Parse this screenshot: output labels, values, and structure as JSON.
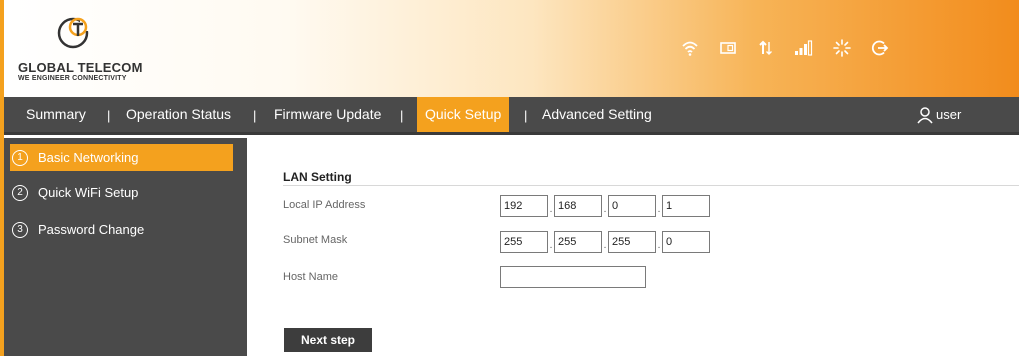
{
  "brand": {
    "name": "GLOBAL TELECOM",
    "tagline": "WE ENGINEER CONNECTIVITY"
  },
  "status_icons": [
    "wifi-icon",
    "sim-card-icon",
    "data-transfer-icon",
    "signal-strength-icon",
    "loading-icon",
    "logout-icon"
  ],
  "nav": {
    "items": [
      {
        "label": "Summary"
      },
      {
        "label": "Operation Status"
      },
      {
        "label": "Firmware Update"
      },
      {
        "label": "Quick Setup"
      },
      {
        "label": "Advanced Setting"
      }
    ],
    "separator": "|",
    "active": "Quick Setup",
    "user_label": "user"
  },
  "sidebar": {
    "items": [
      {
        "num": "1",
        "label": "Basic Networking"
      },
      {
        "num": "2",
        "label": "Quick WiFi Setup"
      },
      {
        "num": "3",
        "label": "Password Change"
      }
    ],
    "active": "Basic Networking"
  },
  "lan": {
    "title": "LAN Setting",
    "local_ip_label": "Local IP Address",
    "local_ip": [
      "192",
      "168",
      "0",
      "1"
    ],
    "subnet_label": "Subnet Mask",
    "subnet": [
      "255",
      "255",
      "255",
      "0"
    ],
    "host_label": "Host Name",
    "host_value": "",
    "dot": "."
  },
  "actions": {
    "next_label": "Next step"
  },
  "colors": {
    "accent": "#f4a11e",
    "nav_bg": "#4a4a4a",
    "button_bg": "#3d3d3d"
  }
}
